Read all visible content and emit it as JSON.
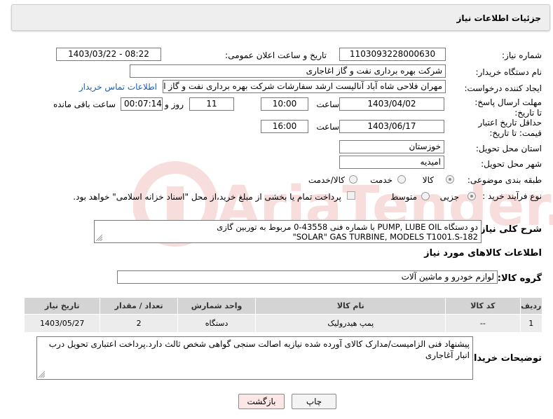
{
  "header": {
    "title": "جزئیات اطلاعات نیاز"
  },
  "fields": {
    "need_number": {
      "label": "شماره نیاز:",
      "value": "1103093228000630"
    },
    "announce_datetime": {
      "label": "تاریخ و ساعت اعلان عمومی:",
      "value": "1403/03/22 - 08:22"
    },
    "buyer_org": {
      "label": "نام دستگاه خریدار:",
      "value": "شرکت بهره برداری نفت و گاز اغاجاری"
    },
    "requester": {
      "label": "ایجاد کننده درخواست:",
      "value": "مهران فلاحی شاه آباد آنالیست ارشد سفارشات شرکت بهره برداری نفت و گاز ا",
      "contact_link": "اطلاعات تماس خریدار"
    },
    "reply_deadline": {
      "label": "مهلت ارسال پاسخ: تا تاریخ:",
      "date": "1403/04/02",
      "time_label": "ساعت",
      "time": "10:00",
      "days": "11",
      "days_label": "روز و",
      "remaining": "00:07:14",
      "remaining_label": "ساعت باقی مانده"
    },
    "price_validity": {
      "label": "حداقل تاریخ اعتبار قیمت: تا تاریخ:",
      "date": "1403/06/17",
      "time_label": "ساعت",
      "time": "16:00"
    },
    "province": {
      "label": "استان محل تحویل:",
      "value": "خوزستان"
    },
    "city": {
      "label": "شهر محل تحویل:",
      "value": "امیدیه"
    },
    "category": {
      "label": "طبقه بندی موضوعی:",
      "options": [
        "کالا",
        "خدمت",
        "کالا/خدمت"
      ],
      "selected": "کالا"
    },
    "purchase_type": {
      "label": "نوع فرآیند خرید :",
      "options": [
        "جزیی",
        "متوسط"
      ],
      "selected": "جزیی",
      "note": "پرداخت تمام یا بخشی از مبلغ خرید،از محل \"اسناد خزانه اسلامی\" خواهد بود."
    }
  },
  "description": {
    "label": "شرح کلی نیاز:",
    "line1": "دو دستگاه PUMP, LUBE OIL با شماره فنی 43558-0 مربوط به توربین گازی",
    "line2": "SOLAR\" GAS TURBINE, MODELS T1001.S-182\""
  },
  "goods_section": {
    "title": "اطلاعات کالاهای مورد نیاز"
  },
  "goods_group": {
    "label": "گروه کالا:",
    "value": "لوازم خودرو و ماشین آلات"
  },
  "table": {
    "headers": [
      "ردیف",
      "کد کالا",
      "نام کالا",
      "واحد شمارش",
      "تعداد / مقدار",
      "تاریخ نیاز"
    ],
    "rows": [
      {
        "idx": "1",
        "code": "--",
        "name": "پمپ هیدرولیک",
        "unit": "دستگاه",
        "qty": "2",
        "date": "1403/05/27"
      }
    ]
  },
  "buyer_notes": {
    "label": "توضیحات خریدار:",
    "text": "پیشنهاد فنی الزامیست/مدارک کالای آورده شده نیازبه اصالت سنجی گواهی شخص ثالث دارد.پرداخت اعتباری تحویل درب انبار آغاجاری"
  },
  "buttons": {
    "print": "چاپ",
    "back": "بازگشت"
  },
  "watermark": {
    "text": "AriaTender.neT"
  },
  "colors": {
    "back_button_bg": "#fde6e6",
    "print_button_bg": "#f4f4f4",
    "header_bg": "#eeeeee",
    "table_header_bg": "#d4d4d4",
    "table_row_bg": "#ececec",
    "link": "#1a5fb4"
  }
}
